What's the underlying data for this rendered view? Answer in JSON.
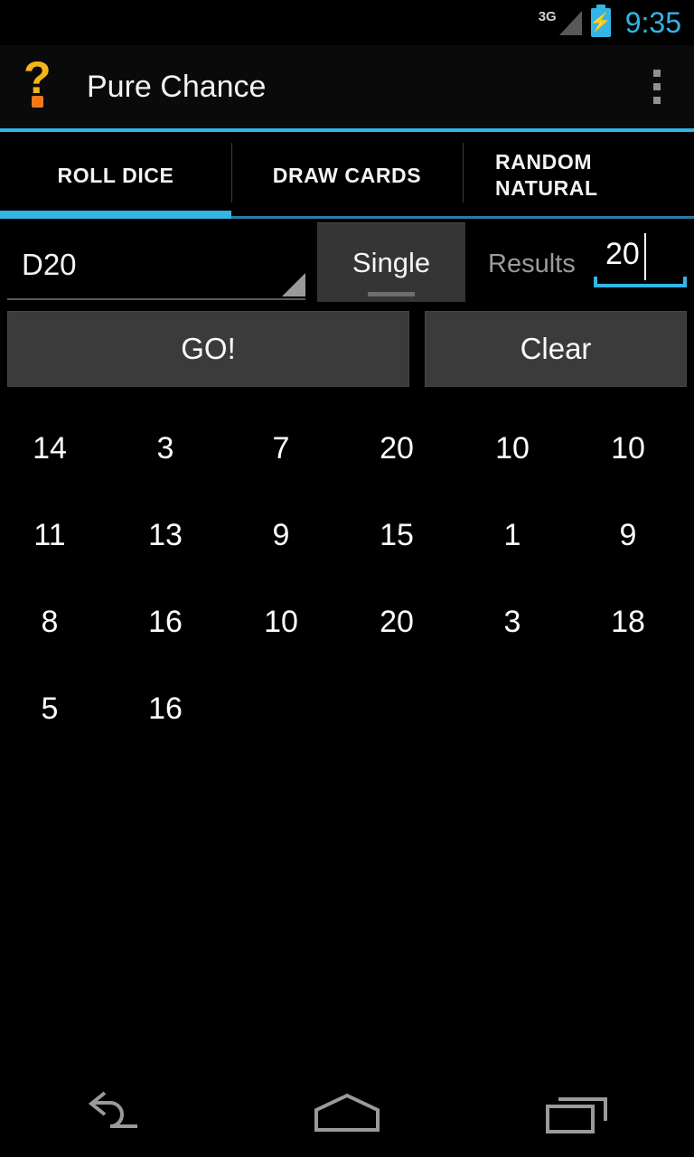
{
  "status_bar": {
    "network_label": "3G",
    "signal_icon": "signal-triangle-icon",
    "battery_icon": "battery-charging-icon",
    "battery_bolt": "⚡",
    "time": "9:35",
    "accent_color": "#33b5e5"
  },
  "action_bar": {
    "app_icon": "question-mark-icon",
    "title": "Pure Chance",
    "overflow_icon": "overflow-menu-icon",
    "accent_color": "#33b5e5"
  },
  "tabs": [
    {
      "label": "ROLL DICE",
      "active": true
    },
    {
      "label": "DRAW CARDS",
      "active": false
    },
    {
      "label": "RANDOM\nNATURAL",
      "active": false
    }
  ],
  "controls": {
    "dice_spinner": {
      "value": "D20",
      "dropdown_icon": "dropdown-triangle-icon"
    },
    "mode_spinner": {
      "value": "Single"
    },
    "results_label": "Results",
    "results_count": "20"
  },
  "buttons": {
    "go": "GO!",
    "clear": "Clear"
  },
  "results": {
    "rows": [
      [
        "14",
        "3",
        "7",
        "20",
        "10",
        "10"
      ],
      [
        "11",
        "13",
        "9",
        "15",
        "1",
        "9"
      ],
      [
        "8",
        "16",
        "10",
        "20",
        "3",
        "18"
      ],
      [
        "5",
        "16",
        "",
        "",
        "",
        ""
      ]
    ]
  },
  "nav_bar": {
    "back": "back-icon",
    "home": "home-icon",
    "recents": "recents-icon"
  }
}
